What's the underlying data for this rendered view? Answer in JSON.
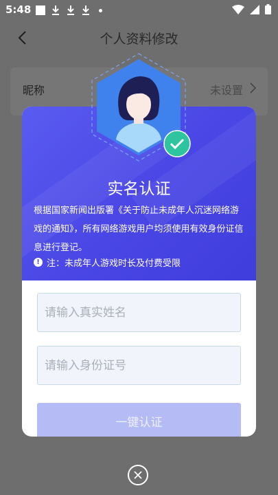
{
  "status_bar": {
    "time": "5:48"
  },
  "title_bar": {
    "title": "个人资料修改"
  },
  "profile_row": {
    "label": "昵称",
    "value": "未设置"
  },
  "dialog": {
    "title": "实名认证",
    "description": "根据国家新闻出版署《关于防止未成年人沉迷网络游戏的通知》，所有网络游戏用户均须使用有效身份证信息进行登记。",
    "notice": "注：未成年人游戏时长及付费受限",
    "name_placeholder": "请输入真实姓名",
    "id_placeholder": "请输入身份证号",
    "submit_label": "一键认证"
  },
  "colors": {
    "header_blue": "#4a47e6",
    "verified_green": "#2ec4a0",
    "button_disabled": "#b4bbf5"
  },
  "icons": [
    "back-arrow-icon",
    "chevron-right-icon",
    "verified-check-icon",
    "close-icon",
    "info-icon",
    "wifi-icon",
    "signal-icon",
    "battery-icon",
    "download-icon"
  ]
}
